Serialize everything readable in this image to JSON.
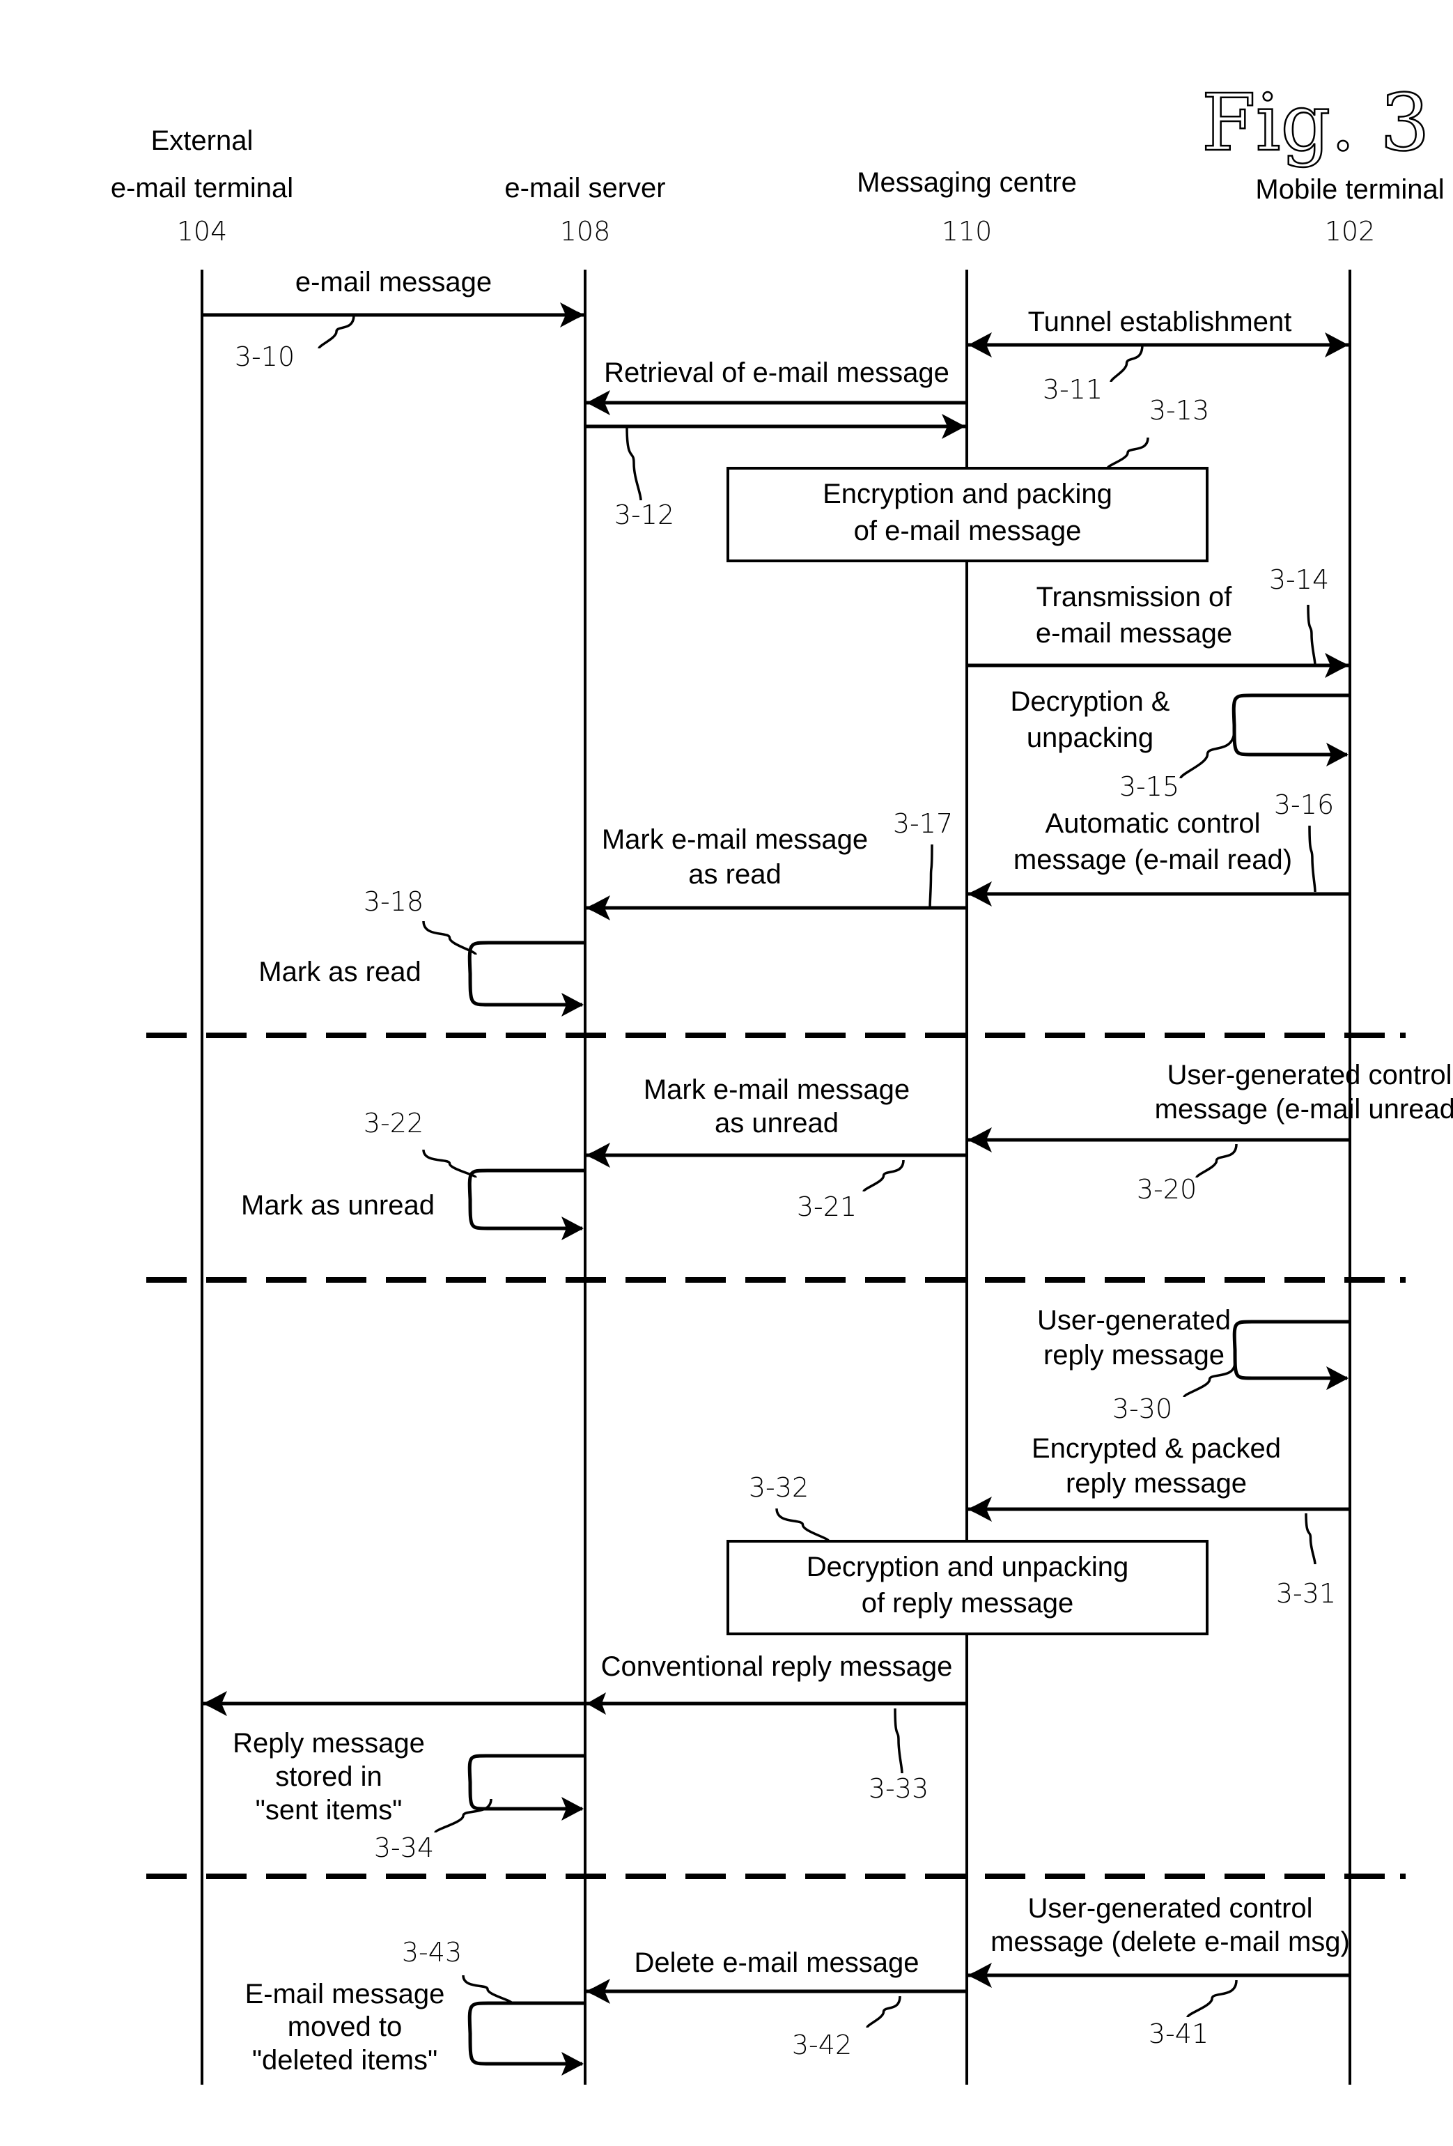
{
  "figure_title": "Fig. 3",
  "participants": [
    {
      "id": "ext",
      "name_lines": [
        "External",
        "e-mail terminal"
      ],
      "ref": "104"
    },
    {
      "id": "srv",
      "name_lines": [
        "e-mail server"
      ],
      "ref": "108"
    },
    {
      "id": "mc",
      "name_lines": [
        "Messaging centre"
      ],
      "ref": "110"
    },
    {
      "id": "mob",
      "name_lines": [
        "Mobile terminal"
      ],
      "ref": "102"
    }
  ],
  "messages": [
    {
      "step": "3-10",
      "from": "ext",
      "to": "srv",
      "kind": "arrow",
      "label": [
        "e-mail message"
      ]
    },
    {
      "step": "3-11",
      "from": "mc",
      "to": "mob",
      "kind": "bidirectional",
      "label": [
        "Tunnel establishment"
      ]
    },
    {
      "step": "3-12",
      "from": "mc",
      "to": "srv",
      "kind": "request-response",
      "label": [
        "Retrieval of e-mail message"
      ]
    },
    {
      "step": "3-13",
      "at": "mc",
      "kind": "process-box",
      "label": [
        "Encryption and packing",
        "of e-mail message"
      ]
    },
    {
      "step": "3-14",
      "from": "mc",
      "to": "mob",
      "kind": "arrow",
      "label": [
        "Transmission of",
        "e-mail message"
      ]
    },
    {
      "step": "3-15",
      "at": "mob",
      "kind": "self-loop",
      "label": [
        "Decryption &",
        "unpacking"
      ]
    },
    {
      "step": "3-16",
      "from": "mob",
      "to": "mc",
      "kind": "arrow",
      "label": [
        "Automatic control",
        "message (e-mail read)"
      ]
    },
    {
      "step": "3-17",
      "from": "mc",
      "to": "srv",
      "kind": "arrow",
      "label": [
        "Mark e-mail message",
        "as read"
      ]
    },
    {
      "step": "3-18",
      "at": "srv",
      "kind": "self-loop",
      "label": [
        "Mark as read"
      ]
    },
    {
      "step": "3-20",
      "from": "mob",
      "to": "mc",
      "kind": "arrow",
      "label": [
        "User-generated control",
        "message (e-mail unread)"
      ]
    },
    {
      "step": "3-21",
      "from": "mc",
      "to": "srv",
      "kind": "arrow",
      "label": [
        "Mark e-mail message",
        "as unread"
      ]
    },
    {
      "step": "3-22",
      "at": "srv",
      "kind": "self-loop",
      "label": [
        "Mark as unread"
      ]
    },
    {
      "step": "3-30",
      "at": "mob",
      "kind": "self-loop",
      "label": [
        "User-generated",
        "reply message"
      ]
    },
    {
      "step": "3-31",
      "from": "mob",
      "to": "mc",
      "kind": "arrow",
      "label": [
        "Encrypted & packed",
        "reply message"
      ]
    },
    {
      "step": "3-32",
      "at": "mc",
      "kind": "process-box",
      "label": [
        "Decryption and unpacking",
        "of reply message"
      ]
    },
    {
      "step": "3-33",
      "from": "mc",
      "to": "ext",
      "kind": "arrow",
      "label": [
        "Conventional reply message"
      ]
    },
    {
      "step": "3-34",
      "at": "srv",
      "kind": "self-loop",
      "label": [
        "Reply message",
        "stored in",
        "\"sent items\""
      ]
    },
    {
      "step": "3-41",
      "from": "mob",
      "to": "mc",
      "kind": "arrow",
      "label": [
        "User-generated control",
        "message (delete e-mail msg)"
      ]
    },
    {
      "step": "3-42",
      "from": "mc",
      "to": "srv",
      "kind": "arrow",
      "label": [
        "Delete e-mail message"
      ]
    },
    {
      "step": "3-43",
      "at": "srv",
      "kind": "self-loop",
      "label": [
        "E-mail message",
        "moved to",
        "\"deleted items\""
      ]
    }
  ],
  "section_separators": 3
}
